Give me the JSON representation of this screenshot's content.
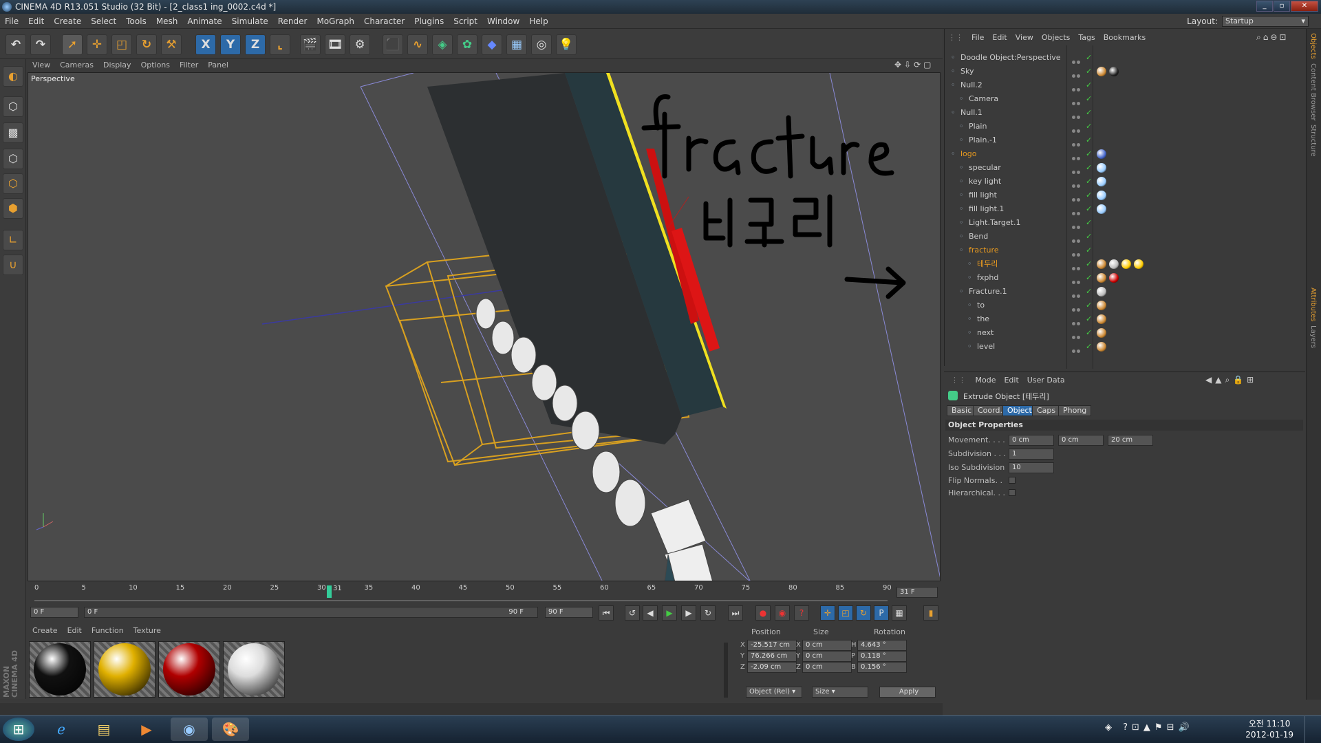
{
  "window": {
    "title": "CINEMA 4D R13.051 Studio (32 Bit) - [2_class1 ing_0002.c4d *]"
  },
  "menubar": [
    "File",
    "Edit",
    "Create",
    "Select",
    "Tools",
    "Mesh",
    "Animate",
    "Simulate",
    "Render",
    "MoGraph",
    "Character",
    "Plugins",
    "Script",
    "Window",
    "Help"
  ],
  "layout": {
    "label": "Layout:",
    "value": "Startup"
  },
  "toolbar": {
    "undo": "undo-icon",
    "redo": "redo-icon",
    "axis_x": "X",
    "axis_y": "Y",
    "axis_z": "Z"
  },
  "viewport": {
    "menu": [
      "View",
      "Cameras",
      "Display",
      "Options",
      "Filter",
      "Panel"
    ],
    "label": "Perspective"
  },
  "timeline": {
    "ticks": [
      "0",
      "5",
      "10",
      "15",
      "20",
      "25",
      "30",
      "35",
      "40",
      "45",
      "50",
      "55",
      "60",
      "65",
      "70",
      "75",
      "80",
      "85",
      "90"
    ],
    "current_marker": "31",
    "current_frame_field": "31 F",
    "start_field": "0 F",
    "range_start": "0 F",
    "range_end": "90 F",
    "end_field": "90 F"
  },
  "materials": {
    "menu": [
      "Create",
      "Edit",
      "Function",
      "Texture"
    ],
    "items": [
      {
        "name": "black-chrome-material",
        "color": "#111111"
      },
      {
        "name": "yellow-material",
        "color": "#e0b000"
      },
      {
        "name": "red-material",
        "color": "#b00000"
      },
      {
        "name": "white-material",
        "color": "#dddddd"
      }
    ]
  },
  "coords": {
    "headers": {
      "position": "Position",
      "size": "Size",
      "rotation": "Rotation"
    },
    "rows": [
      {
        "axis": "X",
        "pos": "-25.517 cm",
        "size_axis": "X",
        "size": "0 cm",
        "rot_axis": "H",
        "rot": "4.643 °"
      },
      {
        "axis": "Y",
        "pos": "76.266 cm",
        "size_axis": "Y",
        "size": "0 cm",
        "rot_axis": "P",
        "rot": "0.118 °"
      },
      {
        "axis": "Z",
        "pos": "-2.09 cm",
        "size_axis": "Z",
        "size": "0 cm",
        "rot_axis": "B",
        "rot": "0.156 °"
      }
    ],
    "mode_select": "Object (Rel)",
    "size_select": "Size",
    "apply": "Apply"
  },
  "objects": {
    "menu": [
      "File",
      "Edit",
      "View",
      "Objects",
      "Tags",
      "Bookmarks"
    ],
    "items": [
      {
        "label": "Doodle Object:Perspective",
        "indent": 0,
        "color": "#cccccc"
      },
      {
        "label": "Sky",
        "indent": 0,
        "color": "#cccccc"
      },
      {
        "label": "Null.2",
        "indent": 0,
        "color": "#cccccc"
      },
      {
        "label": "Camera",
        "indent": 1,
        "color": "#cccccc"
      },
      {
        "label": "Null.1",
        "indent": 0,
        "color": "#cccccc"
      },
      {
        "label": "Plain",
        "indent": 1,
        "color": "#cccccc"
      },
      {
        "label": "Plain.-1",
        "indent": 1,
        "color": "#cccccc"
      },
      {
        "label": "logo",
        "indent": 0,
        "color": "#e89a20"
      },
      {
        "label": "specular",
        "indent": 1,
        "color": "#cccccc"
      },
      {
        "label": "key light",
        "indent": 1,
        "color": "#cccccc"
      },
      {
        "label": "fill light",
        "indent": 1,
        "color": "#cccccc"
      },
      {
        "label": "fill light.1",
        "indent": 1,
        "color": "#cccccc"
      },
      {
        "label": "Light.Target.1",
        "indent": 1,
        "color": "#cccccc"
      },
      {
        "label": "Bend",
        "indent": 1,
        "color": "#cccccc"
      },
      {
        "label": "fracture",
        "indent": 1,
        "color": "#e89a20"
      },
      {
        "label": "테두리",
        "indent": 2,
        "color": "#e89a20"
      },
      {
        "label": "fxphd",
        "indent": 2,
        "color": "#cccccc"
      },
      {
        "label": "Fracture.1",
        "indent": 1,
        "color": "#cccccc"
      },
      {
        "label": "to",
        "indent": 2,
        "color": "#cccccc"
      },
      {
        "label": "the",
        "indent": 2,
        "color": "#cccccc"
      },
      {
        "label": "next",
        "indent": 2,
        "color": "#cccccc"
      },
      {
        "label": "level",
        "indent": 2,
        "color": "#cccccc"
      }
    ]
  },
  "attributes": {
    "menu": [
      "Mode",
      "Edit",
      "User Data"
    ],
    "title": "Extrude Object [테두리]",
    "tabs": [
      "Basic",
      "Coord.",
      "Object",
      "Caps",
      "Phong"
    ],
    "active_tab": "Object",
    "section": "Object Properties",
    "movement_label": "Movement. . . .",
    "movement": [
      "0 cm",
      "0 cm",
      "20 cm"
    ],
    "subdivision_label": "Subdivision . . .",
    "subdivision": "1",
    "iso_label": "Iso Subdivision",
    "iso": "10",
    "flip_label": "Flip Normals. .",
    "hier_label": "Hierarchical. . ."
  },
  "right_tabs": [
    "Objects",
    "Content Browser",
    "Structure",
    "Attributes",
    "Layers"
  ],
  "taskbar": {
    "time": "오전 11:10",
    "date": "2012-01-19"
  },
  "maxon": "MAXON CINEMA 4D"
}
